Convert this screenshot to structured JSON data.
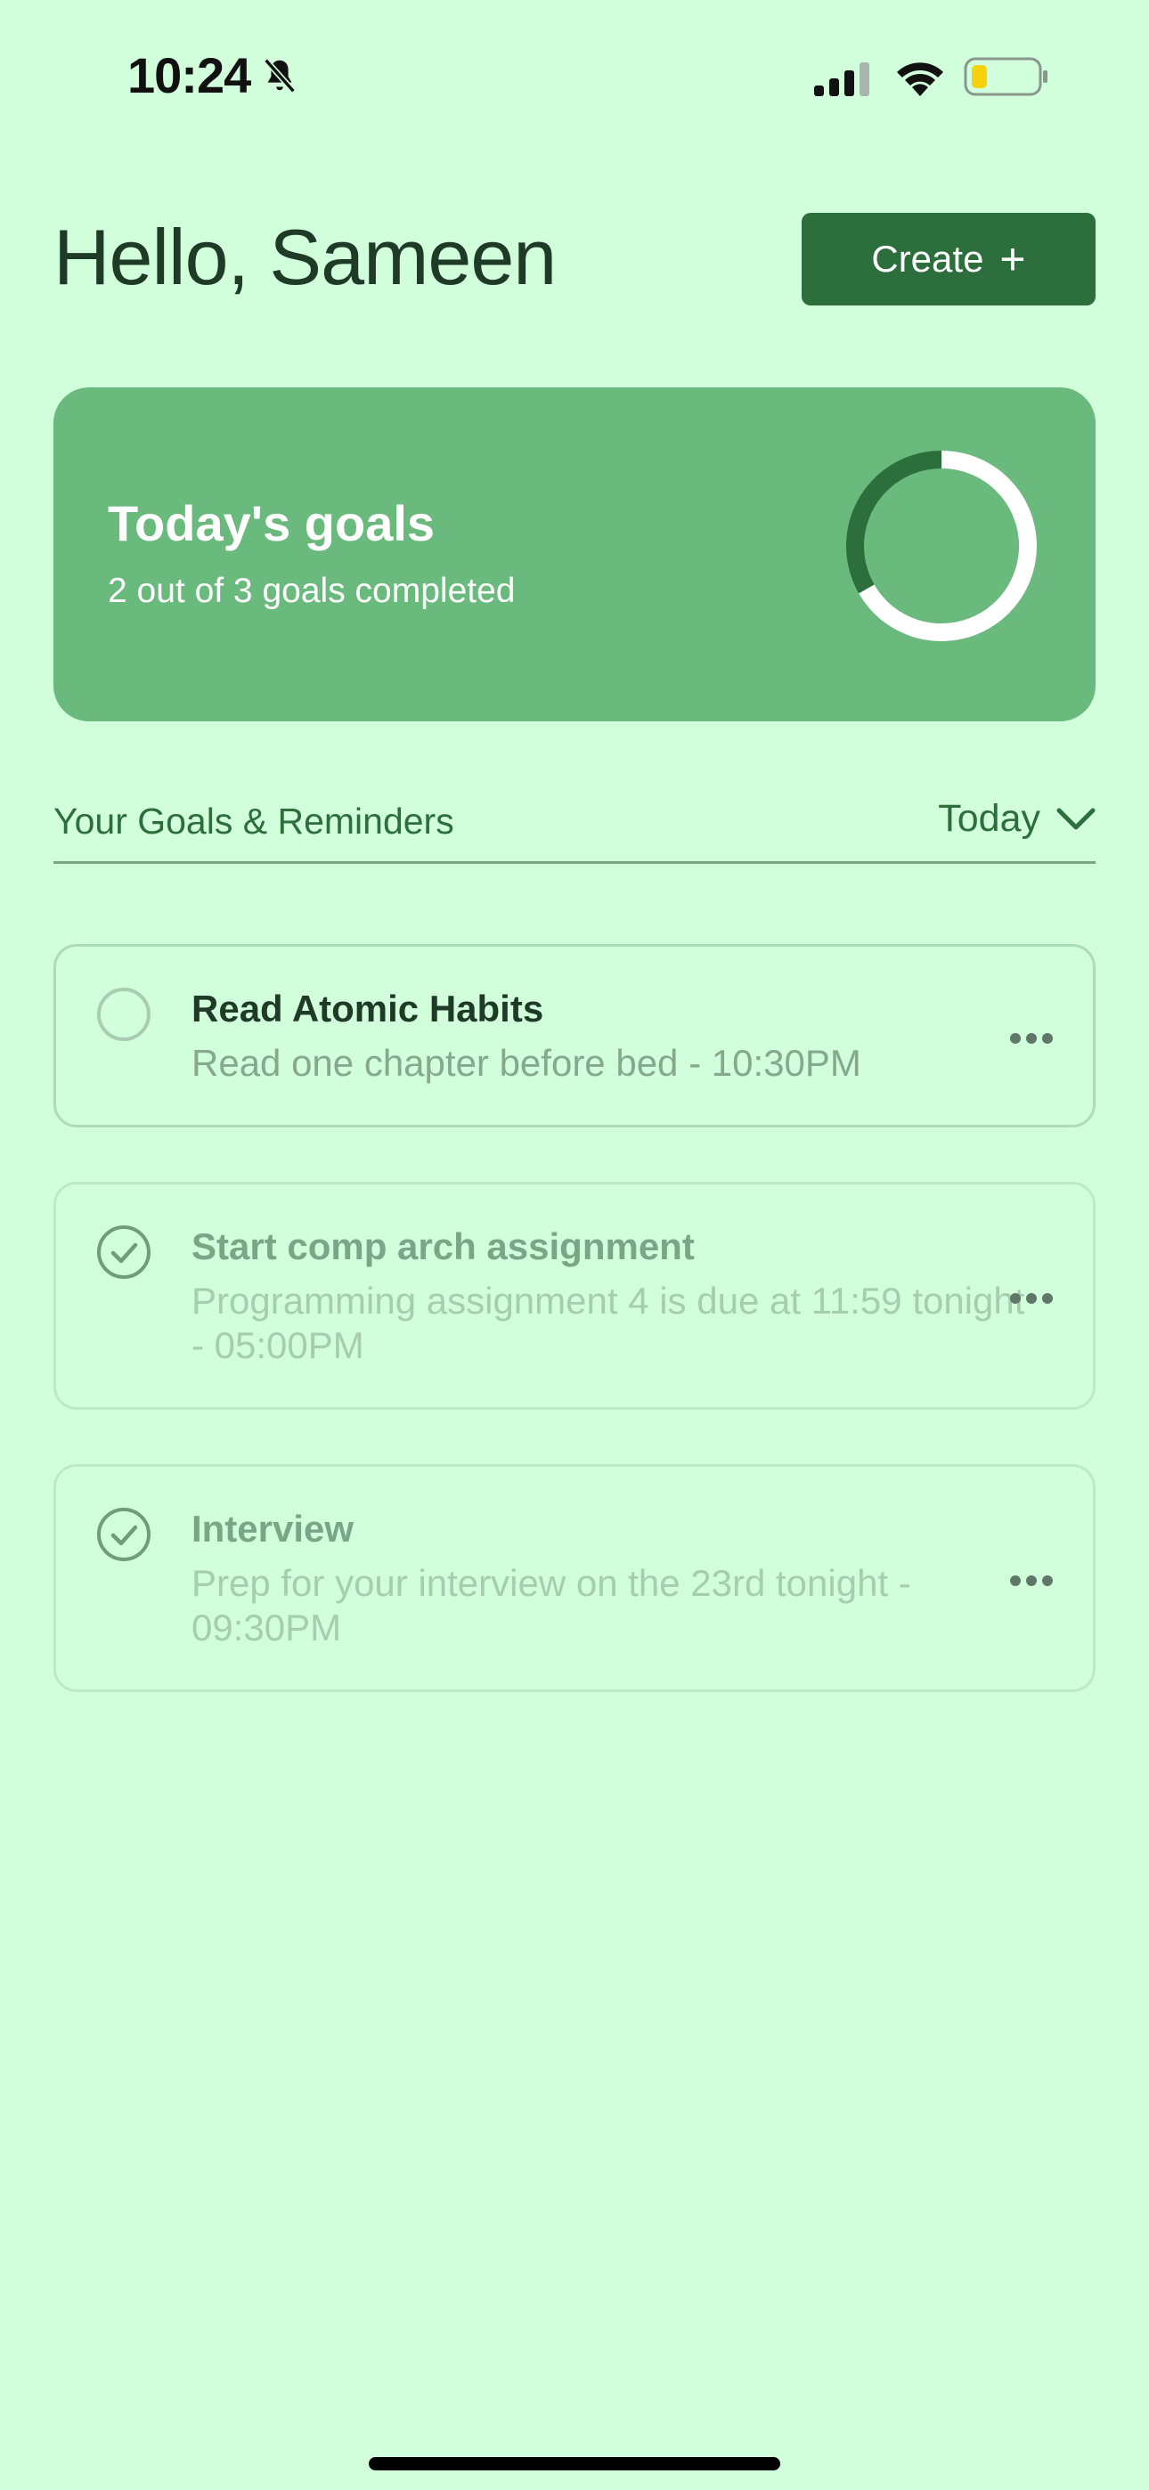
{
  "status_bar": {
    "time": "10:24",
    "icons": [
      "bell-slash-icon",
      "signal-icon",
      "wifi-icon",
      "battery-icon"
    ]
  },
  "header": {
    "greeting": "Hello, Sameen",
    "create_label": "Create",
    "create_icon": "plus-icon"
  },
  "summary": {
    "title": "Today's goals",
    "subtitle": "2 out of 3 goals completed",
    "completed": 2,
    "total": 3
  },
  "section": {
    "title": "Your Goals & Reminders",
    "filter": "Today"
  },
  "goals": [
    {
      "title": "Read Atomic Habits",
      "description": "Read one chapter before bed - 10:30PM",
      "completed": false
    },
    {
      "title": "Start comp arch assignment",
      "description": "Programming assignment 4 is due at 11:59 tonight - 05:00PM",
      "completed": true
    },
    {
      "title": "Interview",
      "description": "Prep for your interview on the 23rd tonight  - 09:30PM",
      "completed": true
    }
  ],
  "colors": {
    "background": "#d1fedb",
    "accent": "#2c6e3c",
    "card": "#6aba7d"
  }
}
